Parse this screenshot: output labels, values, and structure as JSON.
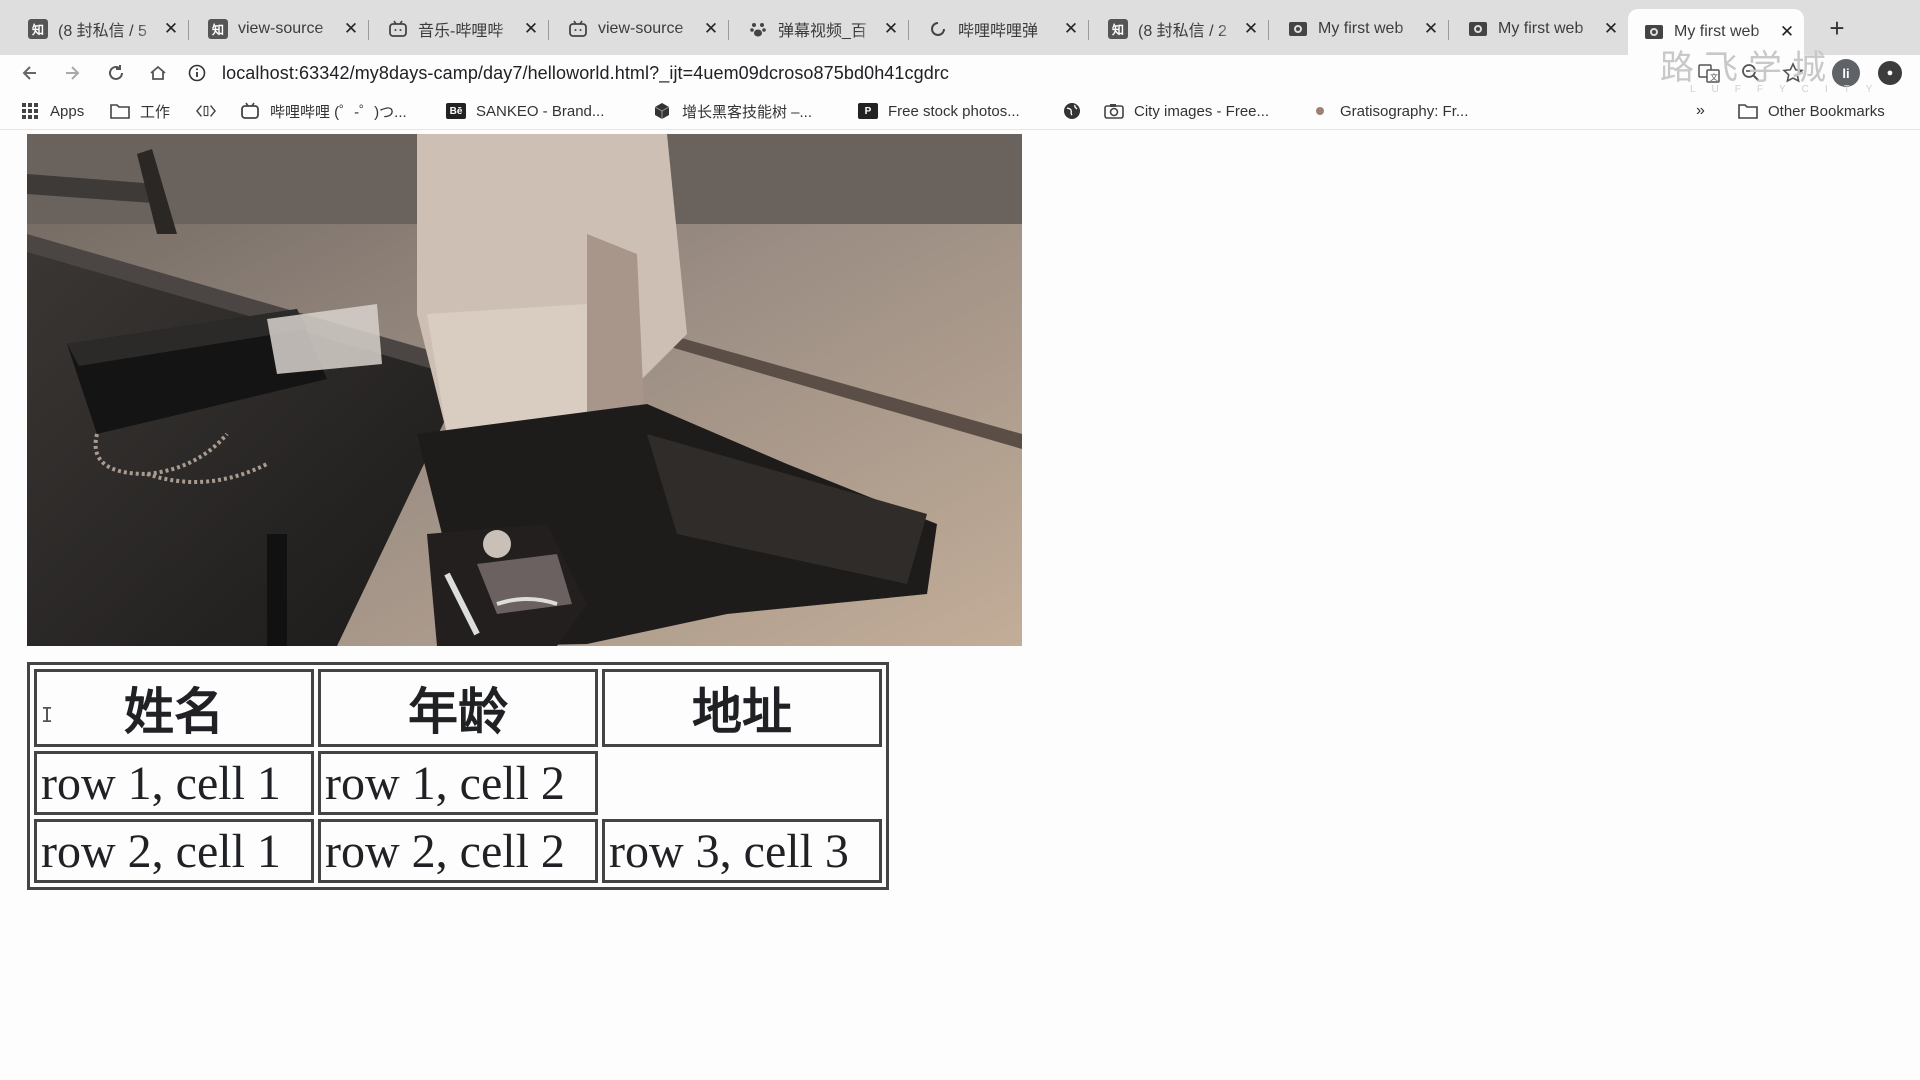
{
  "tabs": [
    {
      "icon": "知",
      "icon_name": "zhihu-icon",
      "title": "(8 封私信 / 5"
    },
    {
      "icon": "知",
      "icon_name": "zhihu-icon",
      "title": "view-source"
    },
    {
      "icon": "tv",
      "icon_name": "bilibili-icon",
      "title": "音乐-哔哩哔"
    },
    {
      "icon": "tv",
      "icon_name": "bilibili-icon",
      "title": "view-source"
    },
    {
      "icon": "paw",
      "icon_name": "baidu-icon",
      "title": "弹幕视频_百"
    },
    {
      "icon": "spin",
      "icon_name": "loading-icon",
      "title": "哔哩哔哩弹"
    },
    {
      "icon": "知",
      "icon_name": "zhihu-icon",
      "title": "(8 封私信 / 2"
    },
    {
      "icon": "web",
      "icon_name": "webpage-icon",
      "title": "My first web"
    },
    {
      "icon": "web",
      "icon_name": "webpage-icon",
      "title": "My first web"
    },
    {
      "icon": "web",
      "icon_name": "webpage-icon",
      "title": "My first web"
    }
  ],
  "toolbar": {
    "url": "localhost:63342/my8days-camp/day7/helloworld.html?_ijt=4uem09dcroso875bd0h41cgdrc",
    "avatar_initial": "li",
    "watermark": "路飞学城",
    "watermark_sub": "LUFFYCITY"
  },
  "bookmarks": {
    "apps_label": "Apps",
    "items": [
      {
        "label": "工作",
        "icon_name": "folder-icon"
      },
      {
        "label": "",
        "icon_name": "code-icon"
      },
      {
        "label": "哔哩哔哩 (゜-゜)つ...",
        "icon_name": "bilibili-icon"
      },
      {
        "label": "SANKEO - Brand...",
        "icon_name": "behance-icon"
      },
      {
        "label": "增长黑客技能树 –...",
        "icon_name": "cube-icon"
      },
      {
        "label": "Free stock photos...",
        "icon_name": "pexels-icon"
      },
      {
        "label": "",
        "icon_name": "globe-icon"
      },
      {
        "label": "City images - Free...",
        "icon_name": "camera-icon"
      },
      {
        "label": "Gratisography: Fr...",
        "icon_name": "dot-icon"
      }
    ],
    "overflow": "»",
    "other": "Other Bookmarks"
  },
  "table": {
    "headers": [
      "姓名",
      "年龄",
      "地址"
    ],
    "rows": [
      [
        "row 1, cell 1",
        "row 1, cell 2",
        ""
      ],
      [
        "row 2, cell 1",
        "row 2, cell 2",
        "row 3, cell 3"
      ]
    ]
  }
}
